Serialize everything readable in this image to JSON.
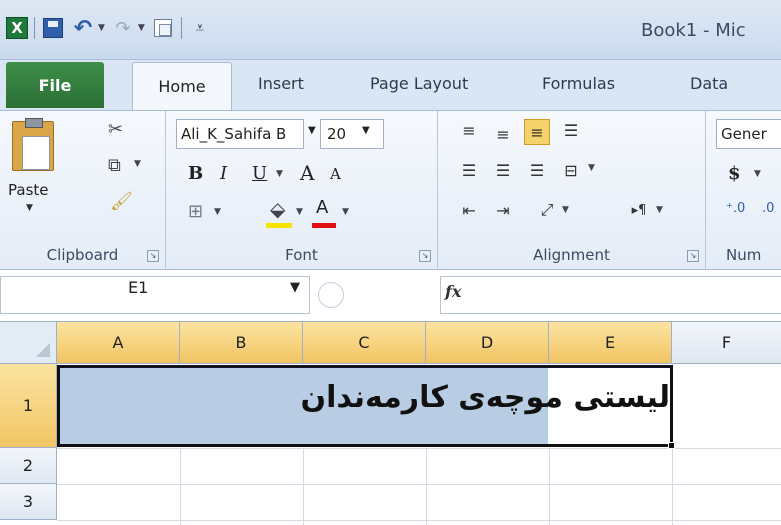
{
  "window": {
    "title": "Book1  -  Mic"
  },
  "qat": {
    "icons": [
      "excel-icon",
      "save-icon",
      "undo-icon",
      "redo-icon",
      "copy-icon",
      "customize-icon"
    ]
  },
  "tabs": {
    "file": "File",
    "home": "Home",
    "insert": "Insert",
    "page_layout": "Page Layout",
    "formulas": "Formulas",
    "data": "Data"
  },
  "ribbon": {
    "clipboard": {
      "label": "Clipboard",
      "paste": "Paste"
    },
    "font": {
      "label": "Font",
      "font_name": "Ali_K_Sahifa B",
      "font_size": "20",
      "bold": "B",
      "italic": "I",
      "underline": "U",
      "grow": "A",
      "shrink": "A",
      "font_color_letter": "A",
      "fill_color": "#f4e400",
      "font_color": "#e01010"
    },
    "alignment": {
      "label": "Alignment"
    },
    "number": {
      "format": "Gener",
      "label": "Num",
      "currency": "$"
    }
  },
  "formula_bar": {
    "name_box": "E1",
    "fx": "fx",
    "value": ""
  },
  "sheet": {
    "columns": [
      "A",
      "B",
      "C",
      "D",
      "E",
      "F"
    ],
    "rows": [
      "1",
      "2",
      "3"
    ],
    "cell_text": "لیستی موچەی کارمەندان"
  }
}
